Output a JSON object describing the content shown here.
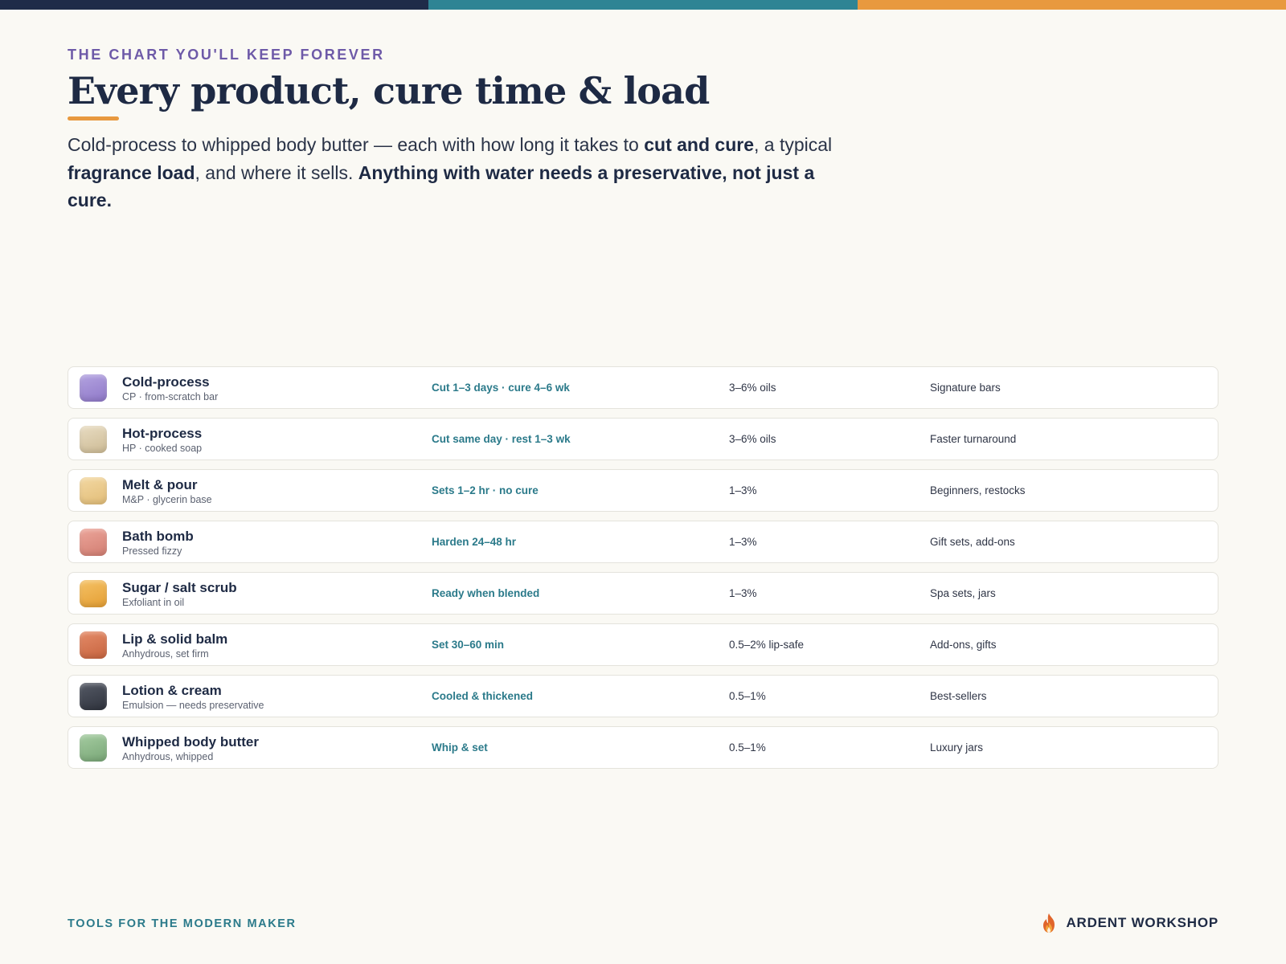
{
  "colors": {
    "navy": "#1f2b49",
    "teal": "#2e8494",
    "orange": "#e8993f",
    "purple_accent": "#6e5aa8"
  },
  "top_bar": [
    "#1f2b49",
    "#2e8494",
    "#e8993f"
  ],
  "header": {
    "eyebrow": "THE CHART YOU'LL KEEP FOREVER",
    "title": "Every product, cure time & load",
    "underline_color": "#e8993f"
  },
  "lede": {
    "t1": "Cold-process to whipped body butter — each with how long it takes to ",
    "b1": "cut and cure",
    "t2": ", a typical ",
    "b2": "fragrance load",
    "t3": ", and where it sells. ",
    "b3": "Anything with water needs a preservative, not just a cure."
  },
  "products": [
    {
      "name": "Cold-process",
      "sub": "CP · from-scratch bar",
      "cure": "Cut 1–3 days · cure 4–6 wk",
      "load": "3–6% oils",
      "sells": "Signature bars",
      "swatch": [
        "#b3a3e0",
        "#8f78c8"
      ]
    },
    {
      "name": "Hot-process",
      "sub": "HP · cooked soap",
      "cure": "Cut same day · rest 1–3 wk",
      "load": "3–6% oils",
      "sells": "Faster turnaround",
      "swatch": [
        "#e8dcc2",
        "#cdbb95"
      ]
    },
    {
      "name": "Melt & pour",
      "sub": "M&P · glycerin base",
      "cure": "Sets 1–2 hr · no cure",
      "load": "1–3%",
      "sells": "Beginners, restocks",
      "swatch": [
        "#f3d8a2",
        "#e2bd78"
      ]
    },
    {
      "name": "Bath bomb",
      "sub": "Pressed fizzy",
      "cure": "Harden 24–48 hr",
      "load": "1–3%",
      "sells": "Gift sets, add-ons",
      "swatch": [
        "#eca59a",
        "#d27e72"
      ]
    },
    {
      "name": "Sugar / salt scrub",
      "sub": "Exfoliant in oil",
      "cure": "Ready when blended",
      "load": "1–3%",
      "sells": "Spa sets, jars",
      "swatch": [
        "#f5c266",
        "#e49e33"
      ]
    },
    {
      "name": "Lip & solid balm",
      "sub": "Anhydrous, set firm",
      "cure": "Set 30–60 min",
      "load": "0.5–2% lip-safe",
      "sells": "Add-ons, gifts",
      "swatch": [
        "#e48b68",
        "#c7643f"
      ]
    },
    {
      "name": "Lotion & cream",
      "sub": "Emulsion — needs preservative",
      "cure": "Cooled & thickened",
      "load": "0.5–1%",
      "sells": "Best-sellers",
      "swatch": [
        "#555a66",
        "#2f333d"
      ]
    },
    {
      "name": "Whipped body butter",
      "sub": "Anhydrous, whipped",
      "cure": "Whip & set",
      "load": "0.5–1%",
      "sells": "Luxury jars",
      "swatch": [
        "#a5cca1",
        "#78a676"
      ]
    }
  ],
  "footer": {
    "left": "TOOLS FOR THE MODERN MAKER",
    "brand": "ARDENT WORKSHOP",
    "brand_icon": "flame-icon"
  }
}
